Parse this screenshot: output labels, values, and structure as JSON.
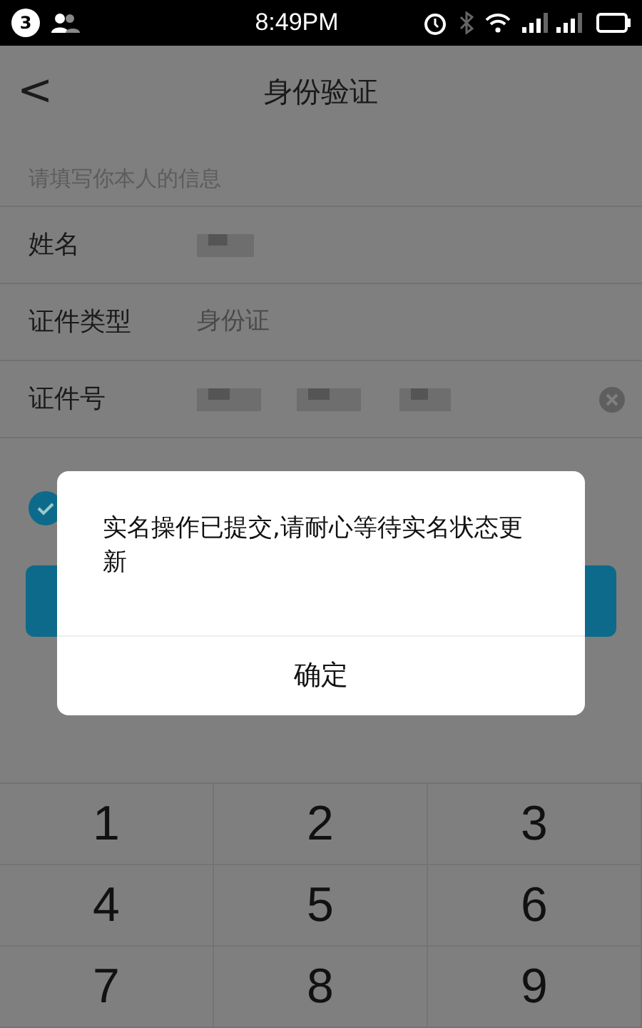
{
  "status_bar": {
    "notification_count": "3",
    "time": "8:49PM"
  },
  "header": {
    "back": "<",
    "title": "身份验证"
  },
  "form": {
    "section_label": "请填写你本人的信息",
    "rows": [
      {
        "label": "姓名",
        "kind": "redacted"
      },
      {
        "label": "证件类型",
        "kind": "text",
        "value": "身份证"
      },
      {
        "label": "证件号",
        "kind": "redacted",
        "clearable": true
      }
    ],
    "agreement": {
      "checked": true
    }
  },
  "dialog": {
    "message": "实名操作已提交,请耐心等待实名状态更新",
    "button": "确定"
  },
  "keypad": {
    "keys": [
      "1",
      "2",
      "3",
      "4",
      "5",
      "6",
      "7",
      "8",
      "9"
    ]
  }
}
